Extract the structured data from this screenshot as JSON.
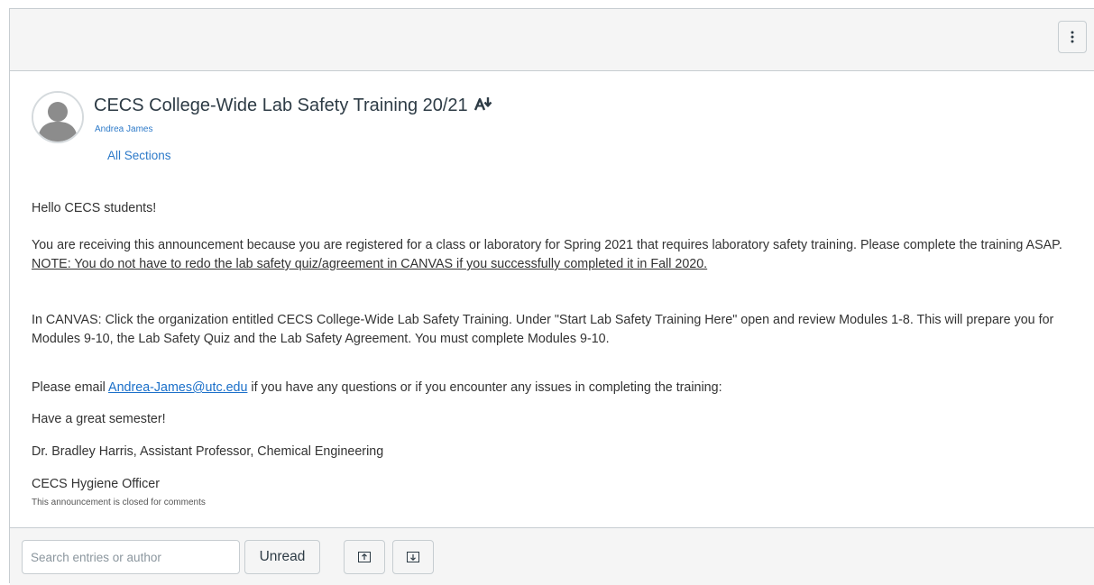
{
  "announcement": {
    "title": "CECS College-Wide Lab Safety Training 20/21",
    "author": "Andrea James",
    "sections": "All Sections",
    "icons": {
      "avatar": "default-avatar-icon",
      "translate": "translate-icon",
      "menu": "kebab-menu-icon"
    }
  },
  "body": {
    "greeting": "Hello CECS students!",
    "p2_text": "You are receiving this announcement because you are registered for a class or laboratory for Spring 2021 that requires laboratory safety training. Please complete the training ASAP.  ",
    "p2_note": "NOTE:  You do not have to redo the lab safety quiz/agreement in CANVAS if you successfully completed it in Fall 2020.",
    "p3": "In CANVAS:  Click the organization entitled CECS College-Wide Lab Safety Training.  Under \"Start Lab Safety Training Here\" open and review Modules 1-8.  This will prepare you for Modules 9-10, the Lab Safety Quiz and the Lab Safety Agreement.  You must complete Modules 9-10.",
    "p4_before": "Please email ",
    "p4_email": "Andrea-James@utc.edu",
    "p4_after": " if you have any questions or if you encounter any issues in completing the training:",
    "p5": "Have a great semester!",
    "p6": "Dr. Bradley Harris, Assistant Professor, Chemical Engineering",
    "p7": "CECS Hygiene Officer",
    "closed_note": "This announcement is closed for comments"
  },
  "toolbar": {
    "search_placeholder": "Search entries or author",
    "unread_label": "Unread",
    "icons": {
      "up": "arrow-up-box-icon",
      "down": "arrow-down-box-icon"
    }
  },
  "colors": {
    "link": "#2d7ac9",
    "bar_background": "#f5f5f5",
    "border": "#c7cdd1",
    "text": "#333333"
  }
}
